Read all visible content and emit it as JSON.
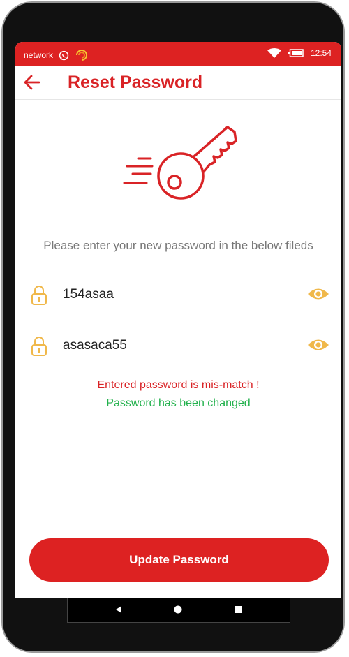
{
  "status_bar": {
    "network_label": "network",
    "time": "12:54",
    "icons": [
      "whatsapp-icon",
      "sync-icon",
      "wifi-icon",
      "battery-icon"
    ]
  },
  "app_bar": {
    "title": "Reset Password",
    "back_icon": "arrow-left-icon"
  },
  "illustration": "key-icon",
  "instructions": "Please enter your new password in the below fileds",
  "fields": [
    {
      "value": "154asaa",
      "icon": "lock-icon",
      "toggle_icon": "eye-icon"
    },
    {
      "value": "asasaca55",
      "icon": "lock-icon",
      "toggle_icon": "eye-icon"
    }
  ],
  "messages": {
    "error": "Entered password is mis-match !",
    "success": "Password has been changed"
  },
  "update_button_label": "Update Password",
  "nav": {
    "icons": [
      "back-triangle-icon",
      "home-circle-icon",
      "recents-square-icon"
    ]
  },
  "colors": {
    "accent": "#dd2222",
    "error": "#d92326",
    "success": "#22b14c",
    "icon_gold": "#f0b84a"
  }
}
